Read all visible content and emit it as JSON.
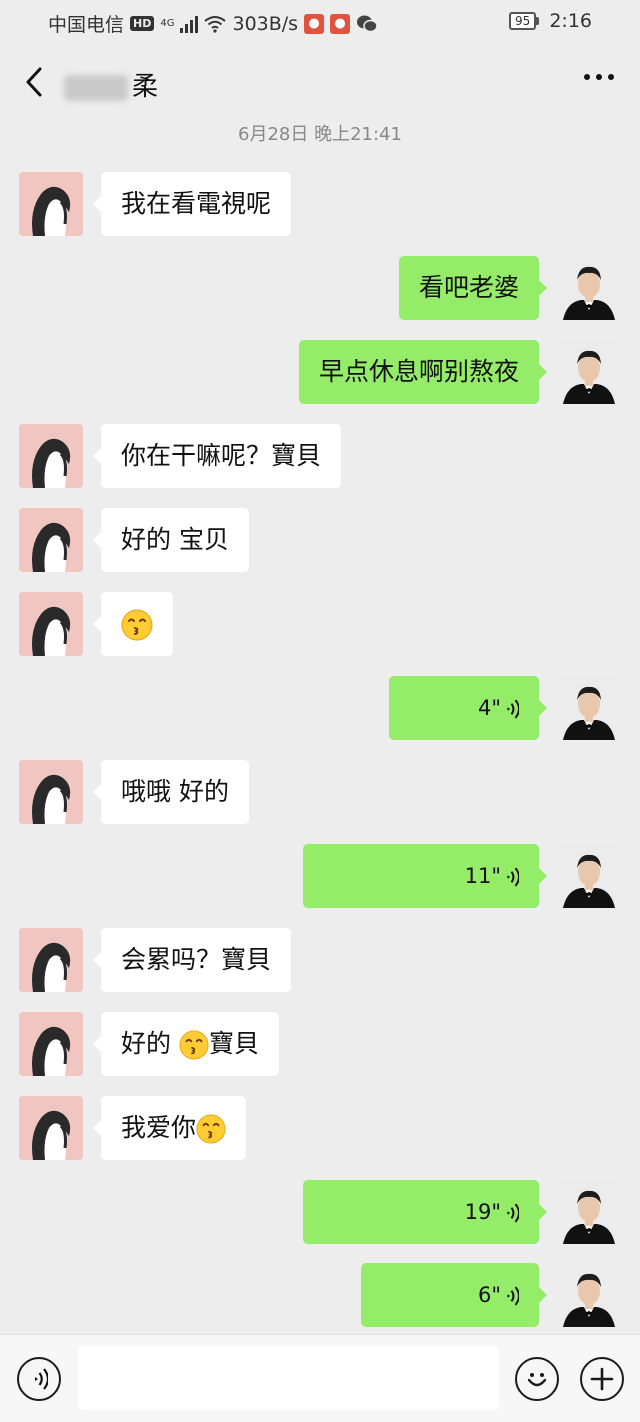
{
  "status_bar": {
    "carrier": "中国电信",
    "hd": "HD",
    "network": "4G",
    "speed": "303B/s",
    "battery": "95",
    "time": "2:16",
    "icons": [
      "wifi-icon",
      "app-badge-icon",
      "app-badge-icon",
      "wechat-icon",
      "battery-icon"
    ]
  },
  "header": {
    "title_visible": "柔",
    "back_icon": "chevron-left-icon",
    "more_icon": "more-dots-icon"
  },
  "timestamp": "6月28日 晚上21:41",
  "messages": [
    {
      "side": "left",
      "type": "text",
      "text": "我在看電視呢"
    },
    {
      "side": "right",
      "type": "text",
      "text": "看吧老婆"
    },
    {
      "side": "right",
      "type": "text",
      "text": "早点休息啊别熬夜"
    },
    {
      "side": "left",
      "type": "text",
      "text": "你在干嘛呢？寶貝"
    },
    {
      "side": "left",
      "type": "text",
      "text": "好的 宝贝"
    },
    {
      "side": "left",
      "type": "emoji",
      "text": ""
    },
    {
      "side": "right",
      "type": "voice",
      "text": "4\""
    },
    {
      "side": "left",
      "type": "text",
      "text": "哦哦 好的"
    },
    {
      "side": "right",
      "type": "voice",
      "text": "11\""
    },
    {
      "side": "left",
      "type": "text",
      "text": "会累吗？寶貝"
    },
    {
      "side": "left",
      "type": "text_emoji",
      "text": "好的 ",
      "text_after": "寶貝"
    },
    {
      "side": "left",
      "type": "text_emoji",
      "text": "我爱你",
      "text_after": ""
    },
    {
      "side": "right",
      "type": "voice",
      "text": "19\""
    },
    {
      "side": "right",
      "type": "voice",
      "text": "6\""
    }
  ],
  "input_bar": {
    "placeholder": "",
    "icons": [
      "voice-toggle-icon",
      "emoji-smile-icon",
      "plus-icon"
    ]
  },
  "colors": {
    "background": "#ededed",
    "sent_bubble": "#95ec69",
    "received_bubble": "#ffffff"
  }
}
